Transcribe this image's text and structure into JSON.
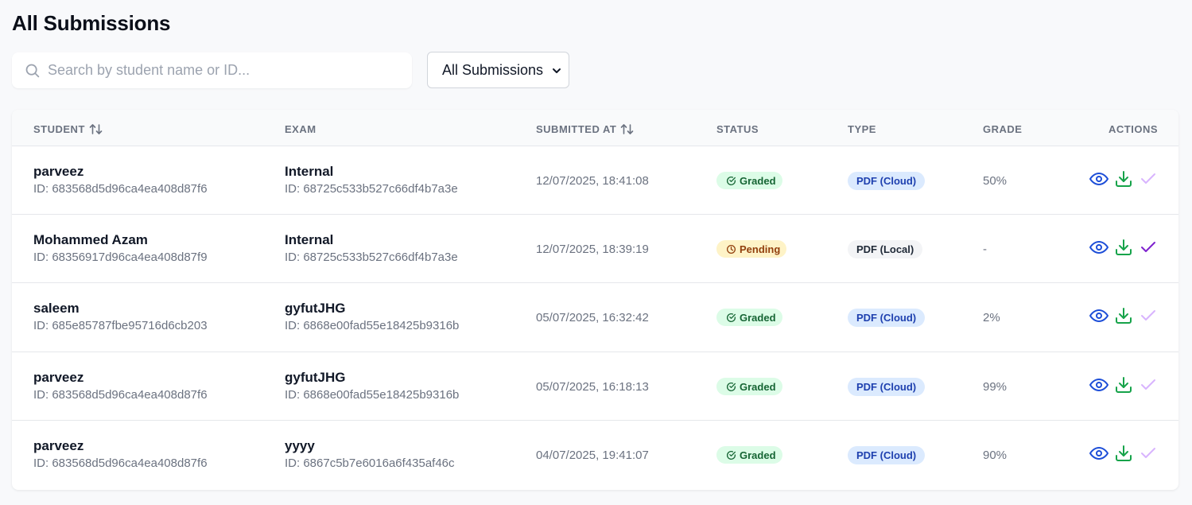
{
  "page": {
    "title": "All Submissions"
  },
  "search": {
    "placeholder": "Search by student name or ID...",
    "value": ""
  },
  "filter": {
    "selected": "All Submissions"
  },
  "table": {
    "headers": {
      "student": "STUDENT",
      "exam": "EXAM",
      "submitted_at": "SUBMITTED AT",
      "status": "STATUS",
      "type": "TYPE",
      "grade": "GRADE",
      "actions": "ACTIONS"
    },
    "rows": [
      {
        "student_name": "parveez",
        "student_id": "ID: 683568d5d96ca4ea408d87f6",
        "exam_name": "Internal",
        "exam_id": "ID: 68725c533b527c66df4b7a3e",
        "submitted_at": "12/07/2025, 18:41:08",
        "status": "Graded",
        "type": "PDF (Cloud)",
        "grade": "50%"
      },
      {
        "student_name": "Mohammed Azam",
        "student_id": "ID: 68356917d96ca4ea408d87f9",
        "exam_name": "Internal",
        "exam_id": "ID: 68725c533b527c66df4b7a3e",
        "submitted_at": "12/07/2025, 18:39:19",
        "status": "Pending",
        "type": "PDF (Local)",
        "grade": "-"
      },
      {
        "student_name": "saleem",
        "student_id": "ID: 685e85787fbe95716d6cb203",
        "exam_name": "gyfutJHG",
        "exam_id": "ID: 6868e00fad55e18425b9316b",
        "submitted_at": "05/07/2025, 16:32:42",
        "status": "Graded",
        "type": "PDF (Cloud)",
        "grade": "2%"
      },
      {
        "student_name": "parveez",
        "student_id": "ID: 683568d5d96ca4ea408d87f6",
        "exam_name": "gyfutJHG",
        "exam_id": "ID: 6868e00fad55e18425b9316b",
        "submitted_at": "05/07/2025, 16:18:13",
        "status": "Graded",
        "type": "PDF (Cloud)",
        "grade": "99%"
      },
      {
        "student_name": "parveez",
        "student_id": "ID: 683568d5d96ca4ea408d87f6",
        "exam_name": "yyyy",
        "exam_id": "ID: 6867c5b7e6016a6f435af46c",
        "submitted_at": "04/07/2025, 19:41:07",
        "status": "Graded",
        "type": "PDF (Cloud)",
        "grade": "90%"
      }
    ]
  },
  "icons": {
    "search": "search-icon",
    "view": "eye-icon",
    "download": "download-icon",
    "grade": "check-icon",
    "sort": "sort-icon"
  },
  "colors": {
    "view": "#1d4ed8",
    "download": "#16a34a",
    "grade_active": "#7e22ce",
    "grade_disabled": "#d8b4fe"
  }
}
